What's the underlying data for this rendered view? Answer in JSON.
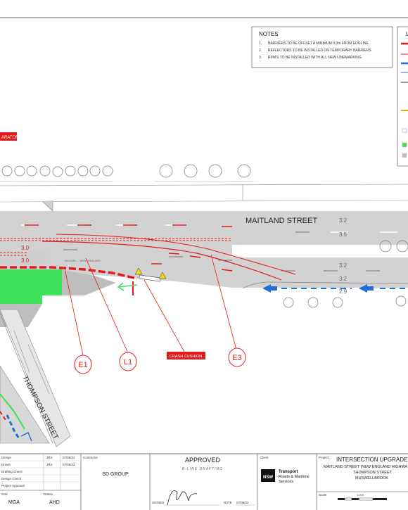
{
  "notes": {
    "heading": "NOTES",
    "items": [
      {
        "num": "1.",
        "text": "BARRIERS TO BE OFFSET A MINIMUM 0.3m FROM EDGLINE"
      },
      {
        "num": "2.",
        "text": "REFLECTORS TO BE INSTALLED ON TEMPORARY BARRIERS"
      },
      {
        "num": "3.",
        "text": "RPM'S TO BE INSTALLED WITH ALL NEW LINEMARKING."
      }
    ]
  },
  "legend_heading_partial": "L",
  "separator_label_partial": "ARATOR",
  "street_labels": {
    "maitland": "MAITLAND  STREET",
    "thompson": "THOMPSON STREET"
  },
  "lane_widths": {
    "right_top": "3.2",
    "right_second": "3.5",
    "right_third": "3.2",
    "right_fourth": "3.2",
    "right_fifth": "2.9",
    "left_upper": "3.0",
    "left_lower": "3.0"
  },
  "small_road_label": "SH 1234 ... NEW ENGLAND",
  "callouts": {
    "e1": "E1",
    "l1": "L1",
    "e3": "E3",
    "crash_cushion": "CRASH CUSHION"
  },
  "title_block": {
    "sign_rows": [
      {
        "role": "Design",
        "initials": "JRS",
        "date": "07/06/22"
      },
      {
        "role": "Drawn",
        "initials": "JRS",
        "date": "07/06/22"
      },
      {
        "role": "Drafting Check",
        "initials": "",
        "date": ""
      },
      {
        "role": "Design Check",
        "initials": "",
        "date": ""
      },
      {
        "role": "Project Approval",
        "initials": "",
        "date": ""
      }
    ],
    "grid_label": "Grid",
    "grid_value": "MGA",
    "datum_label": "Datum",
    "datum_value": "AHD",
    "contractor_label": "Contractor",
    "contractor_value": "SD GROUP",
    "approved": "APPROVED",
    "drafting_firm": "B-LINE DRAFTING",
    "signed_label": "SIGNED",
    "date_label": "DATE",
    "date_value": "07/06/22",
    "client_label": "Client",
    "logo_nsw": "NSW",
    "logo_transport": "Transport",
    "logo_rms1": "Roads & Maritime",
    "logo_rms2": "Services",
    "project_label": "Project",
    "project_title": "INTERSECTION UPGRADE AT",
    "project_line1": "MAITLAND STREET (NEW ENGLAND HIGHWA",
    "project_line2": "THOMPSON STREET",
    "project_line3": "MUSWELLBROOK",
    "scale_label": "Scale",
    "scale_value": "1:200"
  },
  "colors": {
    "red": "#e21b1b",
    "blue": "#1e6fd6",
    "green": "#3fe05a",
    "road_grey": "#d2d2d2",
    "island_grey": "#bdbdbd"
  }
}
